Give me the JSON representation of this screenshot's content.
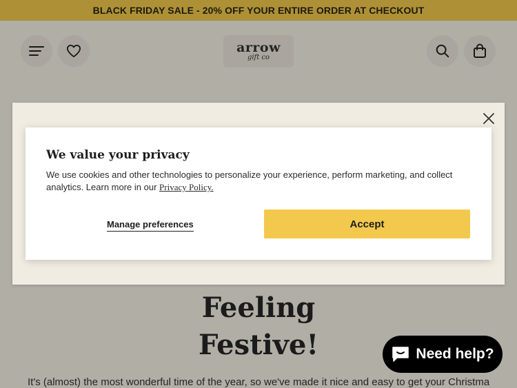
{
  "announcement": {
    "text": "BLACK FRIDAY SALE - 20% OFF YOUR ENTIRE ORDER AT CHECKOUT"
  },
  "header": {
    "logo": {
      "main": "arrow",
      "sub": "gift co"
    },
    "icons": {
      "menu": "menu-icon",
      "wishlist": "heart-icon",
      "search": "search-icon",
      "cart": "bag-icon"
    }
  },
  "hero": {
    "heading_line1": "Feeling",
    "heading_line2": "Festive!",
    "text": "It's (almost) the most wonderful time of the year, so we've made it nice and easy to get your Christmas"
  },
  "privacy": {
    "title": "We value your privacy",
    "body": "We use cookies and other technologies to personalize your experience, perform marketing, and collect analytics. Learn more in our ",
    "link": "Privacy Policy.",
    "manage_label": "Manage preferences",
    "accept_label": "Accept"
  },
  "chat": {
    "label": "Need help?"
  },
  "colors": {
    "accent": "#f2ca4d",
    "background": "#f6f1e7",
    "button_bg": "#ece7dd"
  }
}
